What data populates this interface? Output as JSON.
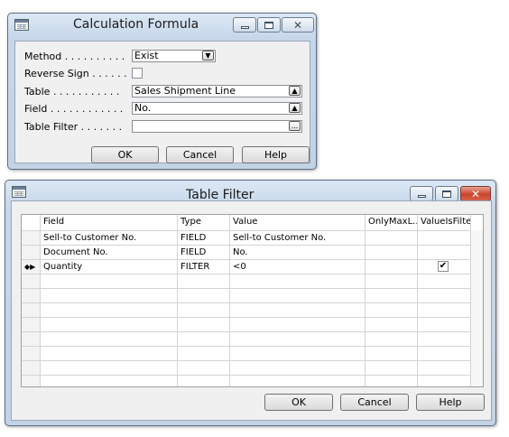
{
  "calc_window": {
    "title": "Calculation Formula",
    "method_label": "Method . . . . . . . . . .",
    "method_value": "Exist",
    "reverse_sign_label": "Reverse Sign . . . . . .",
    "reverse_sign_checked": false,
    "table_label": "Table . . . . . . . . . . .",
    "table_value": "Sales Shipment Line",
    "field_label": "Field . . . . . . . . . . . .",
    "field_value": "No.",
    "table_filter_label": "Table Filter . . . . . . .",
    "table_filter_value": "",
    "lookup_button": "...",
    "ok_button": "OK",
    "cancel_button": "Cancel",
    "help_button": "Help"
  },
  "filter_window": {
    "title": "Table Filter",
    "columns": [
      "Field",
      "Type",
      "Value",
      "OnlyMaxL...",
      "ValueIsFilter"
    ],
    "rows": [
      {
        "field": "Sell-to Customer No.",
        "type": "FIELD",
        "value": "Sell-to Customer No.",
        "value_is_filter": false
      },
      {
        "field": "Document No.",
        "type": "FIELD",
        "value": "No.",
        "value_is_filter": false
      },
      {
        "field": "Quantity",
        "type": "FILTER",
        "value": "<0",
        "value_is_filter": true
      }
    ],
    "current_row_marker": "◆▶",
    "ok_button": "OK",
    "cancel_button": "Cancel",
    "help_button": "Help"
  },
  "colors": {
    "window_border": "#5e6f86",
    "titlebar": "#c6d7ea",
    "client_bg": "#f0f0f0",
    "close_red": "#c9442c"
  }
}
